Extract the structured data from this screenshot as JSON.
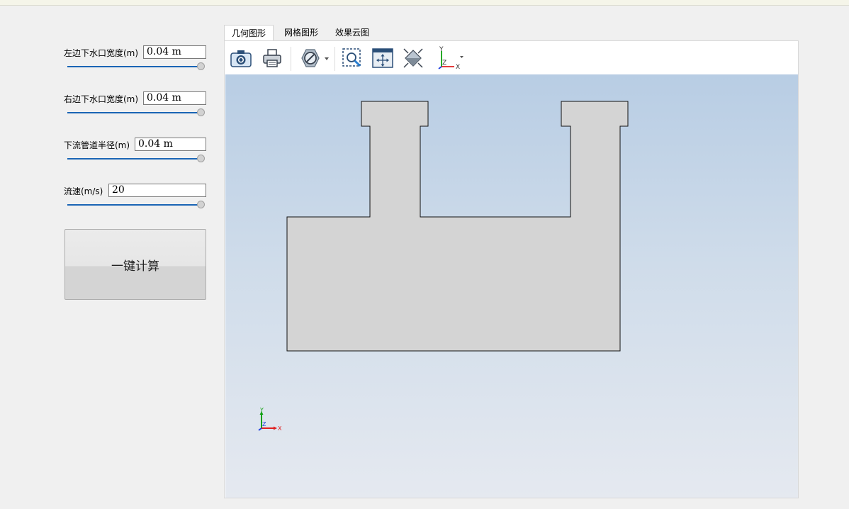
{
  "params": {
    "left_width": {
      "label": "左边下水口宽度(m)",
      "value": "0.04 m",
      "slider_fraction": 1.0
    },
    "right_width": {
      "label": "右边下水口宽度(m)",
      "value": "0.04 m",
      "slider_fraction": 1.0
    },
    "pipe_radius": {
      "label": "下流管道半径(m)",
      "value": "0.04 m",
      "slider_fraction": 1.0
    },
    "flow_speed": {
      "label": "流速(m/s)",
      "value": "20",
      "slider_fraction": 1.0
    }
  },
  "calc_button": {
    "label": "一键计算"
  },
  "tabs": [
    {
      "label": "几何图形",
      "active": true
    },
    {
      "label": "网格图形",
      "active": false
    },
    {
      "label": "效果云图",
      "active": false
    }
  ],
  "toolbar": {
    "icons": [
      "camera-icon",
      "print-icon",
      "display-style-icon",
      "zoom-box-icon",
      "fit-view-icon",
      "iso-view-icon",
      "axes-icon"
    ]
  },
  "axes": {
    "x": "X",
    "y": "Y",
    "z": "Z"
  },
  "colors": {
    "accent": "#1a65b5",
    "shape_fill": "#d4d4d4",
    "viewport_top": "#b8cde4",
    "viewport_bottom": "#e5e9f0",
    "axis_x": "#e02020",
    "axis_y": "#10a010",
    "axis_z": "#2040e0"
  }
}
